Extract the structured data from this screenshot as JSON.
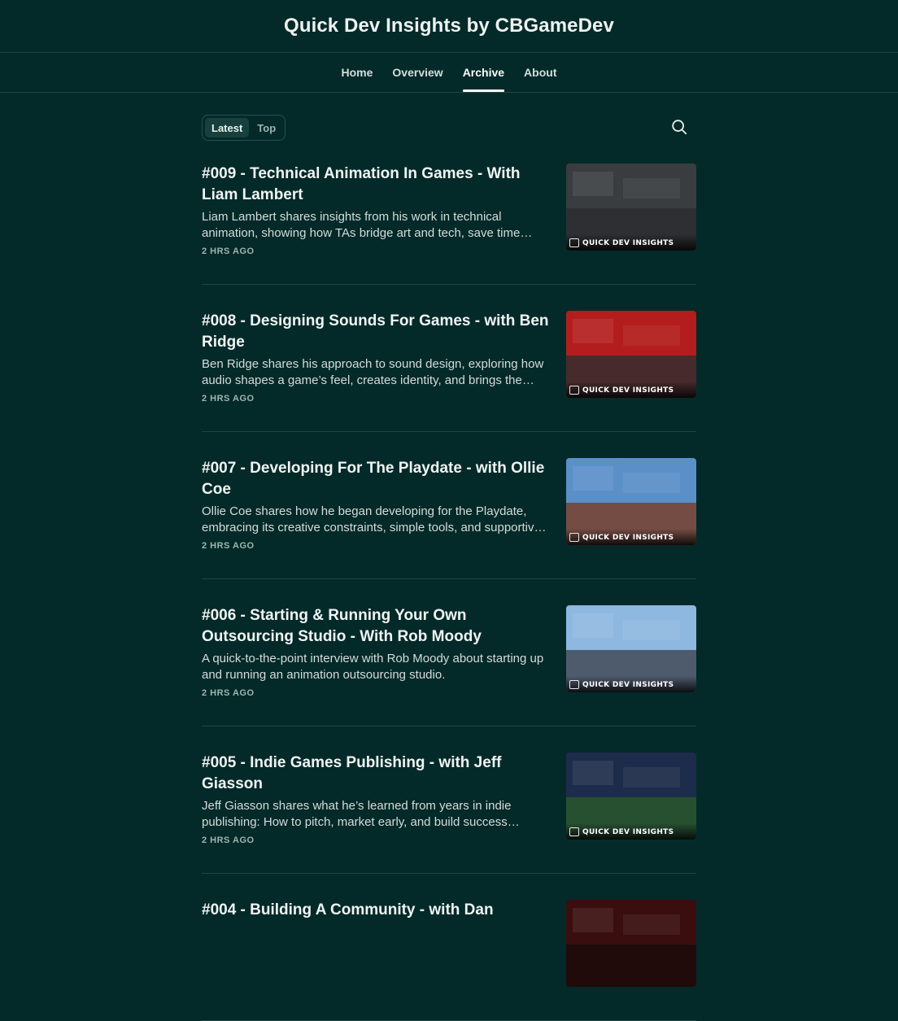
{
  "header": {
    "title": "Quick Dev Insights by CBGameDev"
  },
  "nav": [
    {
      "label": "Home",
      "active": false
    },
    {
      "label": "Overview",
      "active": false
    },
    {
      "label": "Archive",
      "active": true
    },
    {
      "label": "About",
      "active": false
    }
  ],
  "filters": {
    "latest": "Latest",
    "top": "Top",
    "selected": "Latest"
  },
  "search": {
    "icon": "search-icon"
  },
  "posts": [
    {
      "title": "#009 - Technical Animation In Games - With Liam Lambert",
      "description": "Liam Lambert shares insights from his work in technical animation, showing how TAs bridge art and tech, save time…",
      "meta": "2 HRS AGO",
      "thumb_text": "QUICK DEV INSIGHTS",
      "thumb_colors": [
        "#3a3d40",
        "#2a2c2e"
      ]
    },
    {
      "title": "#008 - Designing Sounds For Games - with Ben Ridge",
      "description": "Ben Ridge shares his approach to sound design, exploring how audio shapes a game’s feel, creates identity, and brings the…",
      "meta": "2 HRS AGO",
      "thumb_text": "QUICK DEV INSIGHTS",
      "thumb_colors": [
        "#b31d1d",
        "#2b2e31"
      ]
    },
    {
      "title": "#007 - Developing For The Playdate - with Ollie Coe",
      "description": "Ollie Coe shares how he began developing for the Playdate, embracing its creative constraints, simple tools, and supportiv…",
      "meta": "2 HRS AGO",
      "thumb_text": "QUICK DEV INSIGHTS",
      "thumb_colors": [
        "#5b8fc8",
        "#7a3b22"
      ]
    },
    {
      "title": "#006 - Starting & Running Your Own Outsourcing Studio - With Rob Moody",
      "description": "A quick-to-the-point interview with Rob Moody about starting up and running an animation outsourcing studio.",
      "meta": "2 HRS AGO",
      "thumb_text": "QUICK DEV INSIGHTS",
      "thumb_colors": [
        "#8fb8e0",
        "#3d4450"
      ]
    },
    {
      "title": "#005 - Indie Games Publishing - with Jeff Giasson",
      "description": "Jeff Giasson shares what he’s learned from years in indie publishing: How to pitch, market early, and build success…",
      "meta": "2 HRS AGO",
      "thumb_text": "QUICK DEV INSIGHTS",
      "thumb_colors": [
        "#1d2c4a",
        "#2a5a2a"
      ]
    },
    {
      "title": "#004 - Building A Community - with Dan",
      "description": "",
      "meta": "",
      "thumb_text": "",
      "thumb_colors": [
        "#3a0e0e",
        "#1a0a0a"
      ]
    }
  ]
}
